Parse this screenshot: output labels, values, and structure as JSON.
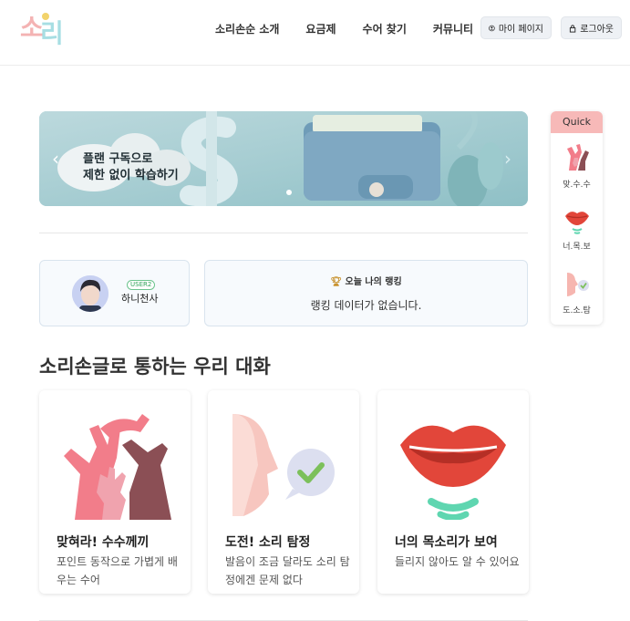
{
  "header": {
    "logo_text": "소리",
    "nav": [
      "소리손순 소개",
      "요금제",
      "수어 찾기",
      "커뮤니티"
    ],
    "mypage_label": "마이 페이지",
    "logout_label": "로그아웃"
  },
  "banner": {
    "line1": "플랜 구독으로",
    "line2": "제한 없이 학습하기",
    "prev_icon": "‹",
    "next_icon": "›"
  },
  "profile": {
    "badge": "USER2",
    "name": "하니천사"
  },
  "ranking": {
    "title": "오늘 나의 랭킹",
    "empty_message": "랭킹 데이터가 없습니다."
  },
  "quick": {
    "title": "Quick",
    "items": [
      {
        "label": "맞.수.수",
        "icon": "hands-icon"
      },
      {
        "label": "너.목.보",
        "icon": "lips-icon"
      },
      {
        "label": "도.소.탐",
        "icon": "face-check-icon"
      }
    ]
  },
  "section": {
    "title": "소리손글로 통하는 우리 대화"
  },
  "features": [
    {
      "title": "맞혀라! 수수께끼",
      "desc": "포인트 동작으로 가볍게 배우는 수어"
    },
    {
      "title": "도전! 소리 탐정",
      "desc": "발음이 조금 달라도 소리 탐정에겐 문제 없다"
    },
    {
      "title": "너의 목소리가 보여",
      "desc": "들리지 않아도 알 수 있어요"
    }
  ],
  "colors": {
    "quick_header": "#f7b9b8",
    "banner_bg": "#aacfd4",
    "lips": "#e2463a",
    "sound_waves": "#5fd6b0"
  }
}
